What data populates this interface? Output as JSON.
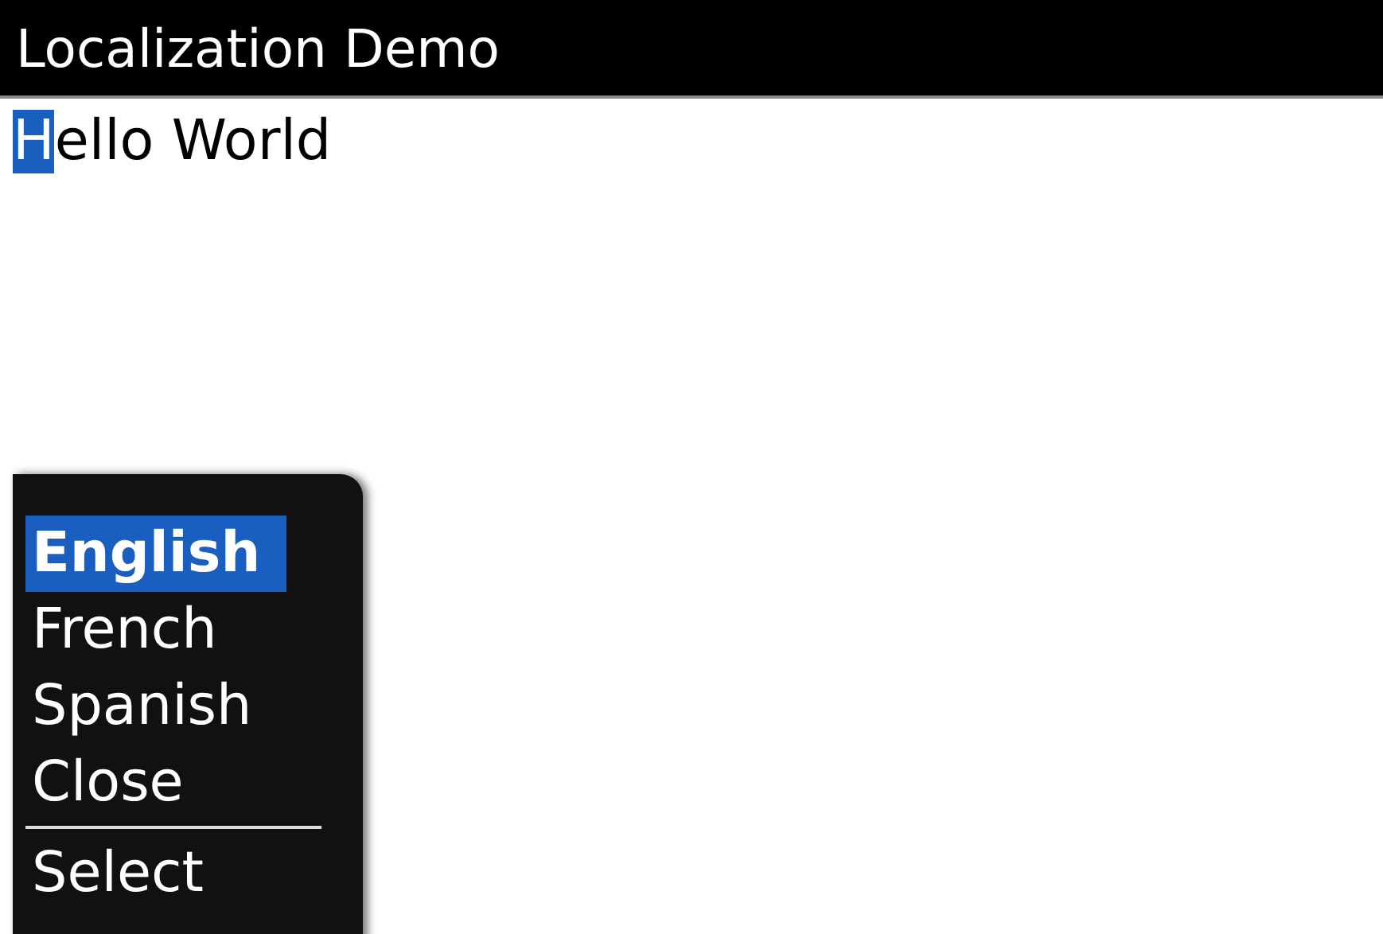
{
  "window": {
    "title": "Localization Demo"
  },
  "editor": {
    "value": "Hello World",
    "cursor": true
  },
  "menu": {
    "items": [
      {
        "label": "English",
        "selected": true
      },
      {
        "label": "French",
        "selected": false
      },
      {
        "label": "Spanish",
        "selected": false
      },
      {
        "label": "Close",
        "selected": false
      }
    ],
    "footer_items": [
      {
        "label": "Select",
        "selected": false
      }
    ]
  }
}
